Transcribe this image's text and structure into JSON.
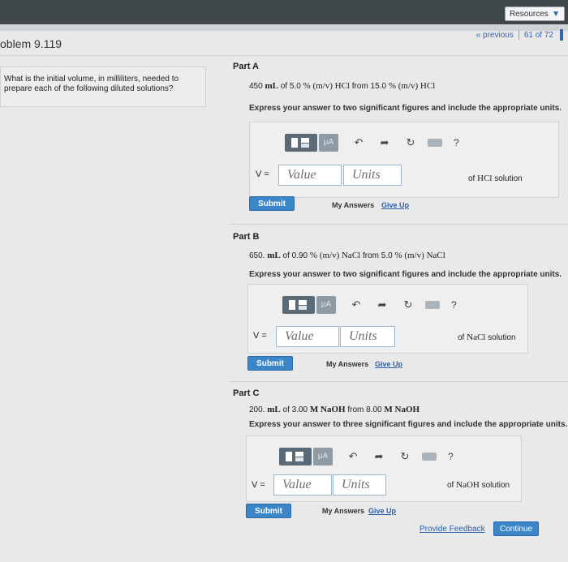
{
  "header": {
    "resources_label": "Resources",
    "previous_label": "« previous",
    "position_label": "61 of 72"
  },
  "problem": {
    "title": "oblem 9.119",
    "question": "What is the initial volume, in milliliters, needed to prepare each of the following diluted solutions?"
  },
  "toolbar": {
    "template_icon": "template-icon",
    "units_button": "μA",
    "icons": [
      "undo-icon",
      "redo-icon",
      "reset-icon",
      "keyboard-icon",
      "help-icon"
    ],
    "help_text": "?"
  },
  "parts": [
    {
      "title": "Part A",
      "prompt_pre": "450 ",
      "prompt_unit1": "mL",
      "prompt_mid1": " of 5.0 ",
      "prompt_conc1": "% (m/v)  HCl",
      "prompt_mid2": " from 15.0 ",
      "prompt_conc2": "% (m/v)  HCl",
      "instructions": "Express your answer to two significant figures and include the appropriate units.",
      "v_label": "V =",
      "value_placeholder": "Value",
      "units_placeholder": "Units",
      "of_pre": "of ",
      "of_chem": "HCl",
      "of_post": " solution",
      "submit": "Submit",
      "my_answers": "My Answers",
      "give_up": "Give Up"
    },
    {
      "title": "Part B",
      "prompt_pre": "650. ",
      "prompt_unit1": "mL",
      "prompt_mid1": " of 0.90 ",
      "prompt_conc1": "% (m/v)  NaCl",
      "prompt_mid2": " from 5.0 ",
      "prompt_conc2": "% (m/v)  NaCl",
      "instructions": "Express your answer to two significant figures and include the appropriate units.",
      "v_label": "V =",
      "value_placeholder": "Value",
      "units_placeholder": "Units",
      "of_pre": "of ",
      "of_chem": "NaCl",
      "of_post": " solution",
      "submit": "Submit",
      "my_answers": "My Answers",
      "give_up": "Give Up"
    },
    {
      "title": "Part C",
      "prompt_pre": "200. ",
      "prompt_unit1": "mL",
      "prompt_mid1": " of 3.00 ",
      "prompt_conc1": "M NaOH",
      "prompt_mid2": " from 8.00 ",
      "prompt_conc2": "M NaOH",
      "instructions": "Express your answer to three significant figures and include the appropriate units.",
      "v_label": "V =",
      "value_placeholder": "Value",
      "units_placeholder": "Units",
      "of_pre": "of ",
      "of_chem": "NaOH",
      "of_post": " solution",
      "submit": "Submit",
      "my_answers": "My Answers",
      "give_up": "Give Up"
    }
  ],
  "footer": {
    "feedback_link": "Provide Feedback",
    "continue_button": "Continue"
  },
  "colors": {
    "accent": "#3a86c9",
    "link": "#2a5fa8",
    "topbar": "#3f4649"
  }
}
